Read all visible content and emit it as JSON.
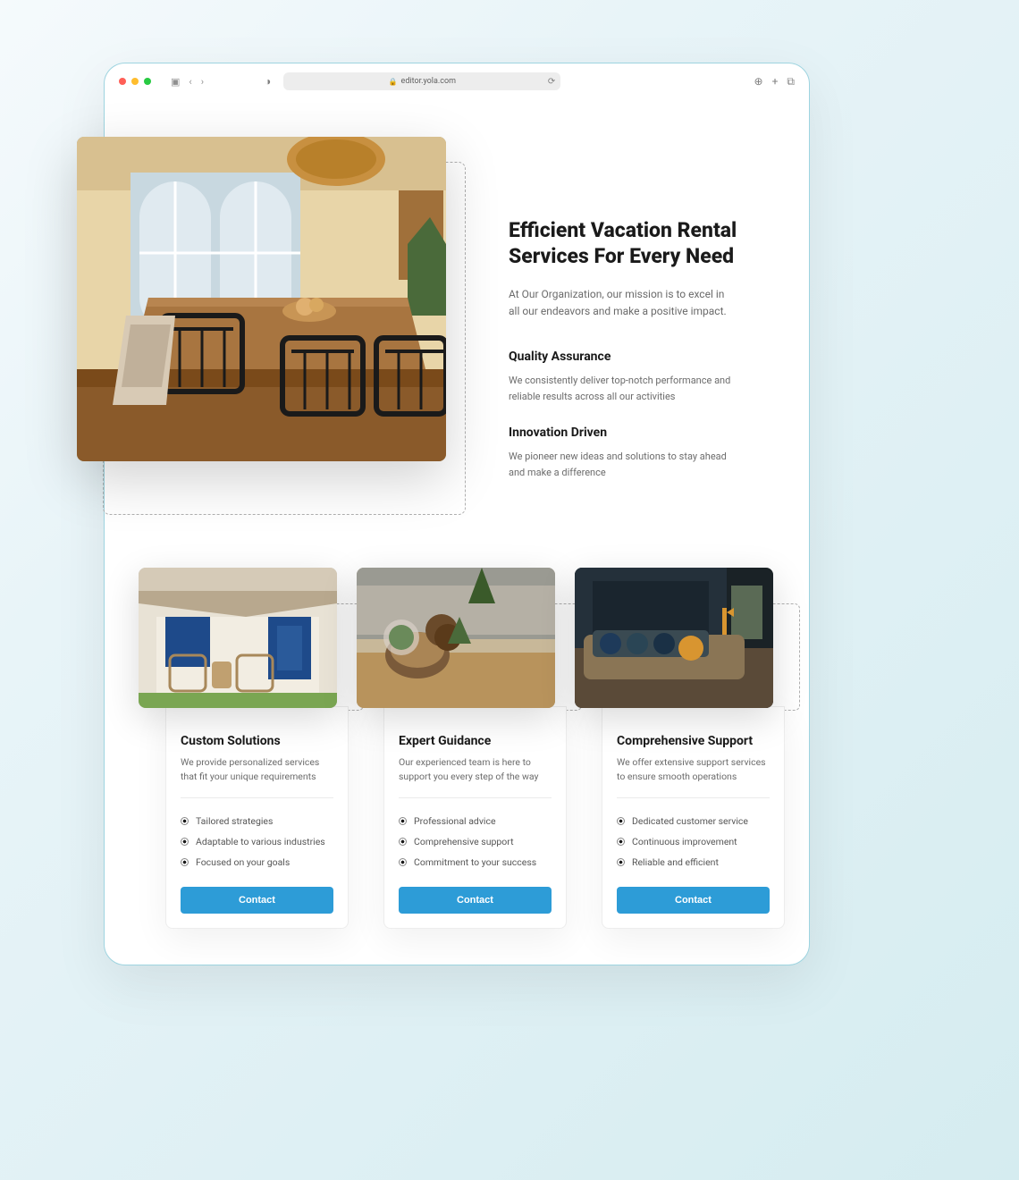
{
  "browser": {
    "url": "editor.yola.com"
  },
  "hero": {
    "title": "Efficient Vacation Rental Services For Every Need",
    "description": "At Our Organization, our mission is to excel in all our endeavors and make a positive impact.",
    "features": [
      {
        "title": "Quality Assurance",
        "description": "We consistently deliver top-notch performance and reliable results across all our activities"
      },
      {
        "title": "Innovation Driven",
        "description": "We pioneer new ideas and solutions to stay ahead and make a difference"
      }
    ]
  },
  "cards": [
    {
      "title": "Custom Solutions",
      "description": "We provide personalized services that fit your unique requirements",
      "bullets": [
        "Tailored strategies",
        "Adaptable to various industries",
        "Focused on your goals"
      ],
      "button": "Contact"
    },
    {
      "title": "Expert Guidance",
      "description": "Our experienced team is here to support you every step of the way",
      "bullets": [
        "Professional advice",
        "Comprehensive support",
        "Commitment to your success"
      ],
      "button": "Contact"
    },
    {
      "title": "Comprehensive Support",
      "description": "We offer extensive support services to ensure smooth operations",
      "bullets": [
        "Dedicated customer service",
        "Continuous improvement",
        "Reliable and efficient"
      ],
      "button": "Contact"
    }
  ]
}
